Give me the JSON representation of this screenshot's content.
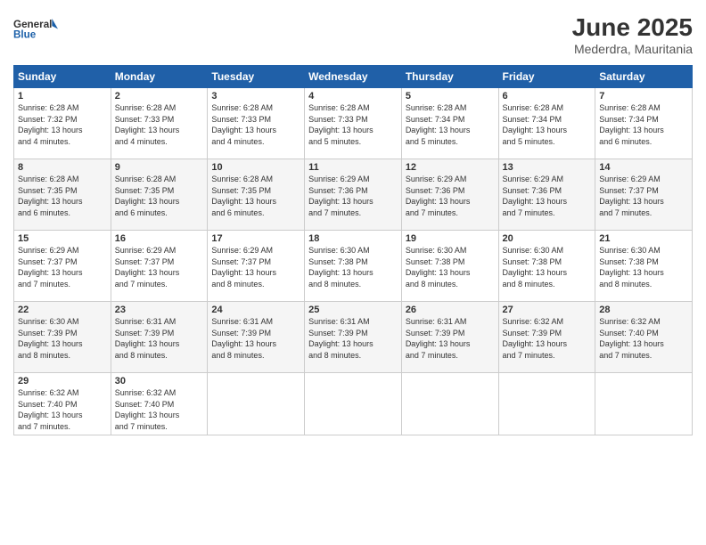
{
  "header": {
    "logo_line1": "General",
    "logo_line2": "Blue",
    "month": "June 2025",
    "location": "Mederdra, Mauritania"
  },
  "days_of_week": [
    "Sunday",
    "Monday",
    "Tuesday",
    "Wednesday",
    "Thursday",
    "Friday",
    "Saturday"
  ],
  "weeks": [
    [
      {
        "day": "1",
        "sunrise": "6:28 AM",
        "sunset": "7:32 PM",
        "daylight": "13 hours and 4 minutes."
      },
      {
        "day": "2",
        "sunrise": "6:28 AM",
        "sunset": "7:33 PM",
        "daylight": "13 hours and 4 minutes."
      },
      {
        "day": "3",
        "sunrise": "6:28 AM",
        "sunset": "7:33 PM",
        "daylight": "13 hours and 4 minutes."
      },
      {
        "day": "4",
        "sunrise": "6:28 AM",
        "sunset": "7:33 PM",
        "daylight": "13 hours and 5 minutes."
      },
      {
        "day": "5",
        "sunrise": "6:28 AM",
        "sunset": "7:34 PM",
        "daylight": "13 hours and 5 minutes."
      },
      {
        "day": "6",
        "sunrise": "6:28 AM",
        "sunset": "7:34 PM",
        "daylight": "13 hours and 5 minutes."
      },
      {
        "day": "7",
        "sunrise": "6:28 AM",
        "sunset": "7:34 PM",
        "daylight": "13 hours and 6 minutes."
      }
    ],
    [
      {
        "day": "8",
        "sunrise": "6:28 AM",
        "sunset": "7:35 PM",
        "daylight": "13 hours and 6 minutes."
      },
      {
        "day": "9",
        "sunrise": "6:28 AM",
        "sunset": "7:35 PM",
        "daylight": "13 hours and 6 minutes."
      },
      {
        "day": "10",
        "sunrise": "6:28 AM",
        "sunset": "7:35 PM",
        "daylight": "13 hours and 6 minutes."
      },
      {
        "day": "11",
        "sunrise": "6:29 AM",
        "sunset": "7:36 PM",
        "daylight": "13 hours and 7 minutes."
      },
      {
        "day": "12",
        "sunrise": "6:29 AM",
        "sunset": "7:36 PM",
        "daylight": "13 hours and 7 minutes."
      },
      {
        "day": "13",
        "sunrise": "6:29 AM",
        "sunset": "7:36 PM",
        "daylight": "13 hours and 7 minutes."
      },
      {
        "day": "14",
        "sunrise": "6:29 AM",
        "sunset": "7:37 PM",
        "daylight": "13 hours and 7 minutes."
      }
    ],
    [
      {
        "day": "15",
        "sunrise": "6:29 AM",
        "sunset": "7:37 PM",
        "daylight": "13 hours and 7 minutes."
      },
      {
        "day": "16",
        "sunrise": "6:29 AM",
        "sunset": "7:37 PM",
        "daylight": "13 hours and 7 minutes."
      },
      {
        "day": "17",
        "sunrise": "6:29 AM",
        "sunset": "7:37 PM",
        "daylight": "13 hours and 8 minutes."
      },
      {
        "day": "18",
        "sunrise": "6:30 AM",
        "sunset": "7:38 PM",
        "daylight": "13 hours and 8 minutes."
      },
      {
        "day": "19",
        "sunrise": "6:30 AM",
        "sunset": "7:38 PM",
        "daylight": "13 hours and 8 minutes."
      },
      {
        "day": "20",
        "sunrise": "6:30 AM",
        "sunset": "7:38 PM",
        "daylight": "13 hours and 8 minutes."
      },
      {
        "day": "21",
        "sunrise": "6:30 AM",
        "sunset": "7:38 PM",
        "daylight": "13 hours and 8 minutes."
      }
    ],
    [
      {
        "day": "22",
        "sunrise": "6:30 AM",
        "sunset": "7:39 PM",
        "daylight": "13 hours and 8 minutes."
      },
      {
        "day": "23",
        "sunrise": "6:31 AM",
        "sunset": "7:39 PM",
        "daylight": "13 hours and 8 minutes."
      },
      {
        "day": "24",
        "sunrise": "6:31 AM",
        "sunset": "7:39 PM",
        "daylight": "13 hours and 8 minutes."
      },
      {
        "day": "25",
        "sunrise": "6:31 AM",
        "sunset": "7:39 PM",
        "daylight": "13 hours and 8 minutes."
      },
      {
        "day": "26",
        "sunrise": "6:31 AM",
        "sunset": "7:39 PM",
        "daylight": "13 hours and 7 minutes."
      },
      {
        "day": "27",
        "sunrise": "6:32 AM",
        "sunset": "7:39 PM",
        "daylight": "13 hours and 7 minutes."
      },
      {
        "day": "28",
        "sunrise": "6:32 AM",
        "sunset": "7:40 PM",
        "daylight": "13 hours and 7 minutes."
      }
    ],
    [
      {
        "day": "29",
        "sunrise": "6:32 AM",
        "sunset": "7:40 PM",
        "daylight": "13 hours and 7 minutes."
      },
      {
        "day": "30",
        "sunrise": "6:32 AM",
        "sunset": "7:40 PM",
        "daylight": "13 hours and 7 minutes."
      },
      null,
      null,
      null,
      null,
      null
    ]
  ],
  "labels": {
    "sunrise": "Sunrise:",
    "sunset": "Sunset:",
    "daylight": "Daylight:"
  }
}
